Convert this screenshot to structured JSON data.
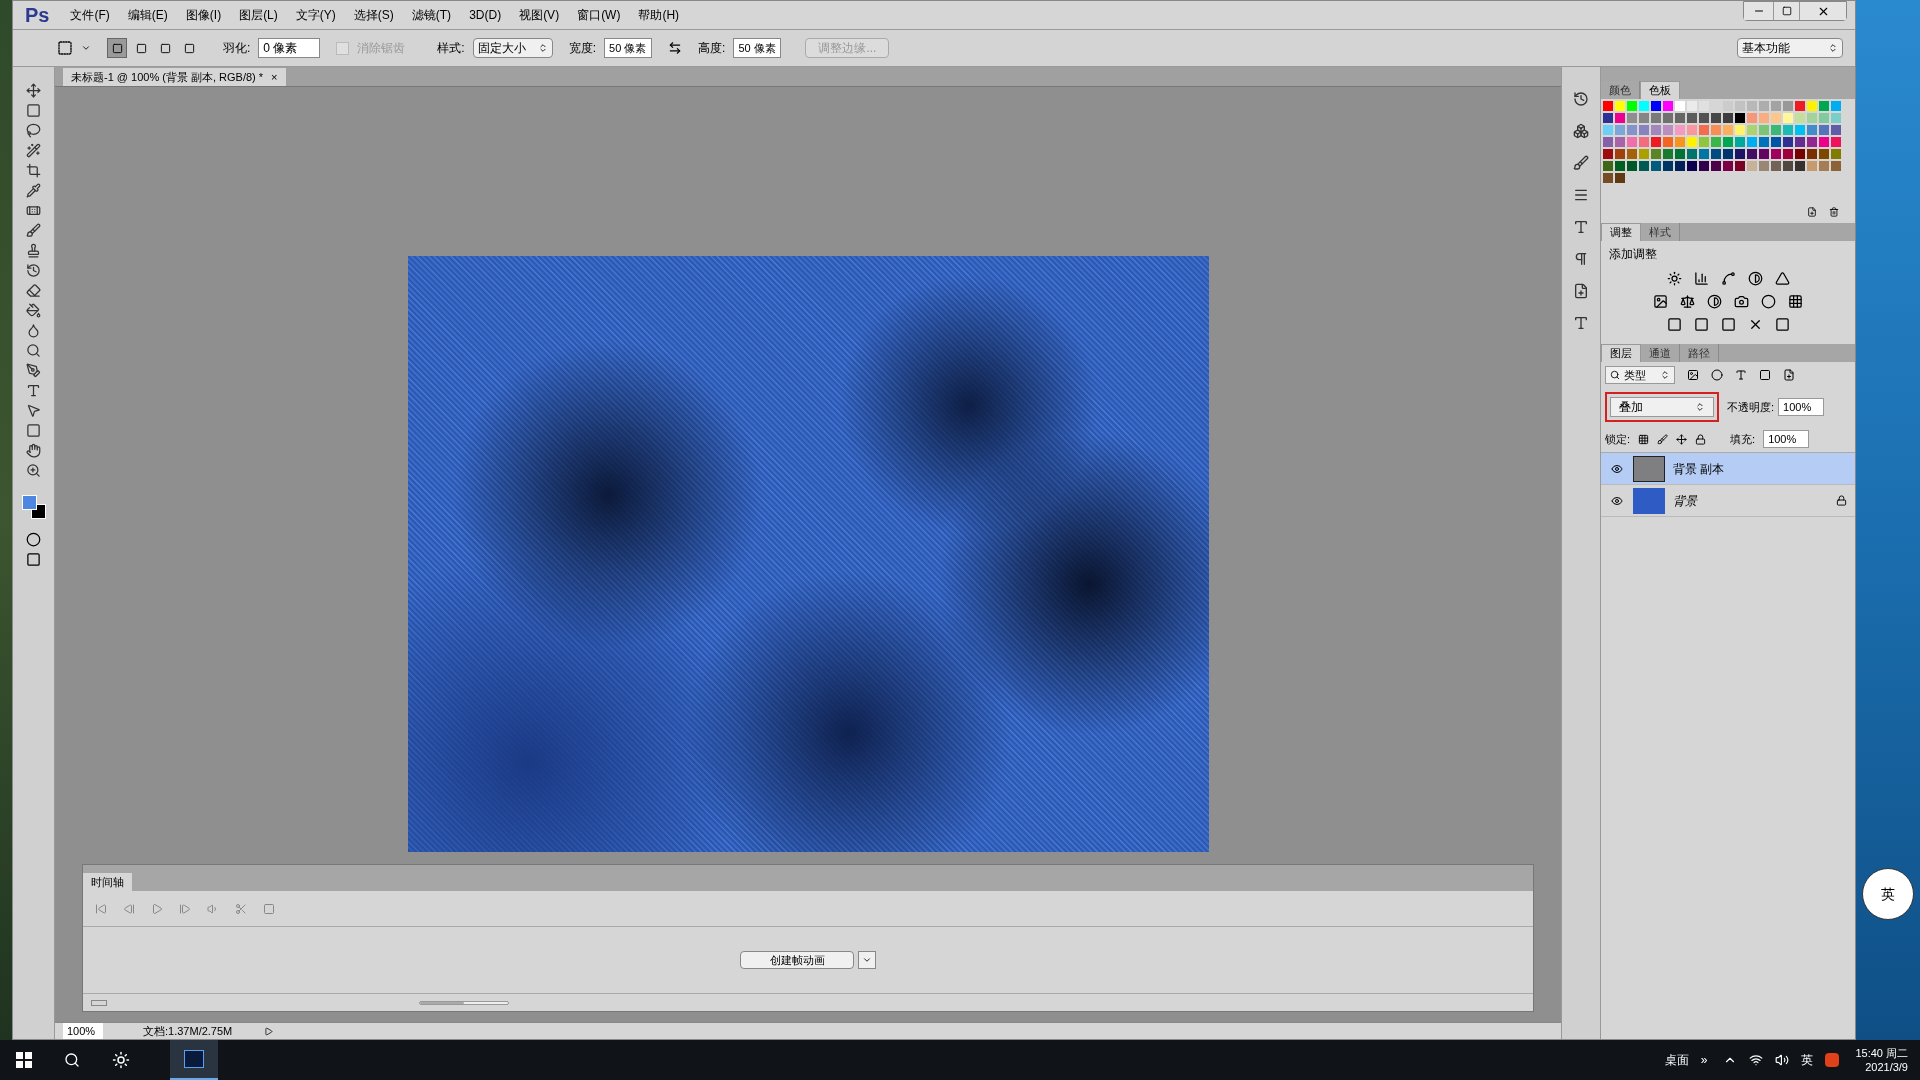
{
  "app": {
    "logo": "Ps"
  },
  "menu": [
    "文件(F)",
    "编辑(E)",
    "图像(I)",
    "图层(L)",
    "文字(Y)",
    "选择(S)",
    "滤镜(T)",
    "3D(D)",
    "视图(V)",
    "窗口(W)",
    "帮助(H)"
  ],
  "options_bar": {
    "selection_modes": [
      {
        "selected": true
      },
      {
        "selected": false
      },
      {
        "selected": false
      },
      {
        "selected": false
      }
    ],
    "feather_label": "羽化:",
    "feather_value": "0 像素",
    "antialias": {
      "label": "消除锯齿",
      "checked": false,
      "disabled": true
    },
    "style_label": "样式:",
    "style_value": "固定大小",
    "width_label": "宽度:",
    "width_value": "50 像素",
    "height_label": "高度:",
    "height_value": "50 像素",
    "refine_button": "调整边缘...",
    "workspace": "基本功能"
  },
  "document_tab": {
    "title": "未标题-1 @ 100% (背景 副本, RGB/8) *",
    "close": "×"
  },
  "swatches_panel": {
    "tabs": [
      {
        "label": "颜色",
        "selected": false
      },
      {
        "label": "色板",
        "selected": true
      }
    ]
  },
  "adjustments_panel": {
    "tabs": [
      {
        "label": "调整",
        "selected": true
      },
      {
        "label": "样式",
        "selected": false
      }
    ],
    "heading": "添加调整"
  },
  "layers_panel": {
    "tabs": [
      {
        "label": "图层",
        "selected": true
      },
      {
        "label": "通道",
        "selected": false
      },
      {
        "label": "路径",
        "selected": false
      }
    ],
    "filter": "类型",
    "blend_mode": {
      "value": "叠加",
      "highlighted": true
    },
    "opacity_label": "不透明度:",
    "opacity": "100%",
    "lock_label": "锁定:",
    "fill_label": "填充:",
    "fill": "100%",
    "layers": [
      {
        "name": "背景 副本",
        "selected": true,
        "visible": true,
        "locked": false
      },
      {
        "name": "背景",
        "selected": false,
        "visible": true,
        "locked": true
      }
    ]
  },
  "timeline": {
    "tab": "时间轴",
    "create_button": "创建帧动画",
    "zoom_slider": {
      "level": 0.5
    }
  },
  "status_bar": {
    "zoom": "100%",
    "document": "文档:1.37M/2.75M"
  },
  "ime_widget": {
    "label": "英"
  },
  "taskbar": {
    "desktop": "桌面",
    "more": "»",
    "language": "英",
    "time": "15:40 周二",
    "date": "2021/3/9"
  }
}
